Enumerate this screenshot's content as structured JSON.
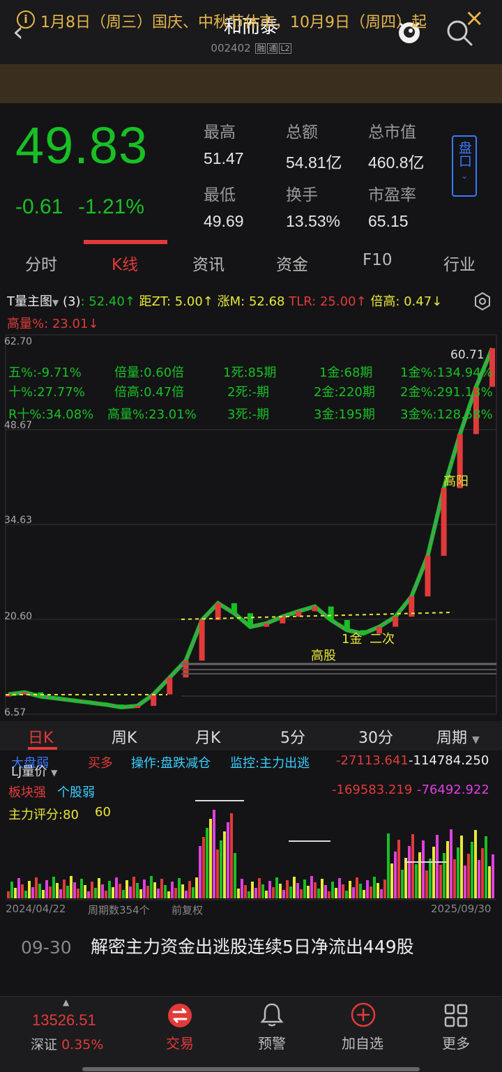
{
  "header": {
    "stock_name": "和而泰",
    "stock_code": "002402",
    "tags": [
      "融",
      "通",
      "L2"
    ]
  },
  "notice": {
    "text": "1月8日（周三）国庆、中秋节休市，10月9日（周四）起"
  },
  "quote": {
    "price": "49.83",
    "change": "-0.61",
    "change_pct": "-1.21%",
    "stats": [
      {
        "label": "最高",
        "value": "51.47"
      },
      {
        "label": "总额",
        "value": "54.81亿"
      },
      {
        "label": "总市值",
        "value": "460.8亿"
      },
      {
        "label": "最低",
        "value": "49.69"
      },
      {
        "label": "换手",
        "value": "13.53%"
      },
      {
        "label": "市盈率",
        "value": "65.15"
      }
    ],
    "pankou_label": "盘口"
  },
  "tabs": [
    "分时",
    "K线",
    "资讯",
    "资金",
    "F10",
    "行业"
  ],
  "indicator": {
    "name": "T量主图",
    "param": "(3)",
    "items": [
      {
        "text": ": 52.40↑",
        "color": "#18c025"
      },
      {
        "text": " 距ZT: 5.00↑",
        "color": "#e8e83a"
      },
      {
        "text": " 涨M: 52.68",
        "color": "#e8e83a"
      },
      {
        "text": " TLR: 25.00↑",
        "color": "#e23a3a"
      },
      {
        "text": " 倍高: 0.47↓",
        "color": "#e8e83a"
      }
    ],
    "line2": "高量%: 23.01↓"
  },
  "chart_stats": [
    [
      "五%:-9.71%",
      "倍量:0.60倍",
      "1死:85期",
      "1金:68期",
      "1金%:134.94%"
    ],
    [
      "十%:27.77%",
      "倍高:0.47倍",
      "2死:-期",
      "2金:220期",
      "2金%:291.13%"
    ],
    [
      "R十%:34.08%",
      "高量%:23.01%",
      "3死:-期",
      "3金:195期",
      "3金%:128.58%"
    ]
  ],
  "chart_axis": {
    "y_labels": [
      "62.70",
      "48.67",
      "34.63",
      "20.60",
      "6.57"
    ],
    "high_label": "60.71",
    "annotations": [
      "高阳",
      "1金",
      "二次",
      "高股"
    ]
  },
  "chart_data": {
    "type": "line",
    "title": "",
    "ylim": [
      6.57,
      62.7
    ],
    "series": [
      {
        "values": [
          9.5,
          9.8,
          9.2,
          8.9,
          8.6,
          8.3,
          8.0,
          7.6,
          7.8,
          9.5,
          12.0,
          14.5,
          20.5,
          23.0,
          21.5,
          19.5,
          20.0,
          21.0,
          21.8,
          22.5,
          20.5,
          19.0,
          18.5,
          19.5,
          21.0,
          24.0,
          30.0,
          40.0,
          48.0,
          55.0,
          60.71
        ]
      }
    ]
  },
  "period_tabs": [
    "日K",
    "周K",
    "月K",
    "5分",
    "30分",
    "周期"
  ],
  "volume_panel": {
    "indicator_name": "LJ量价",
    "line1_left": "大盘弱",
    "line1_buy": "买多",
    "line1_op": "操作:盘跌减仓",
    "line1_monitor": "监控:主力出逃",
    "line1_v1": "-27113.641",
    "line1_v2": "-114784.250",
    "line2_left": "板块强",
    "line2_mid": "个股弱",
    "line2_v1": "-169583.219",
    "line2_v2": "-76492.922",
    "line3": "主力评分:80",
    "line3_b": "60"
  },
  "axis_dates": {
    "start": "2024/04/22",
    "count": "周期数354个",
    "adjust": "前复权",
    "end": "2025/09/30"
  },
  "news": {
    "date": "09-30",
    "title": "解密主力资金出逃股连续5日净流出449股"
  },
  "bottom_nav": {
    "index_value": "13526.51",
    "index_name": "深证",
    "index_change": "0.35%",
    "items": [
      "交易",
      "预警",
      "加自选",
      "更多"
    ]
  },
  "colors": {
    "up": "#e23a3a",
    "down": "#18c025",
    "accent": "#3a78ff",
    "notice": "#e8b64a"
  }
}
